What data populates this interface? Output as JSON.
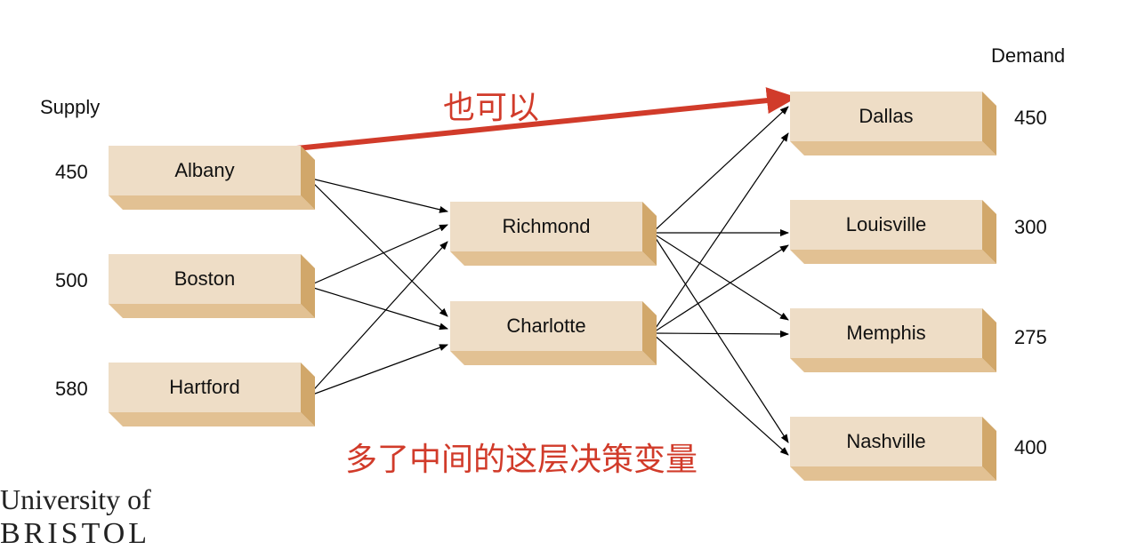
{
  "headers": {
    "supply": "Supply",
    "demand": "Demand"
  },
  "sources": [
    {
      "name": "Albany",
      "supply": "450"
    },
    {
      "name": "Boston",
      "supply": "500"
    },
    {
      "name": "Hartford",
      "supply": "580"
    }
  ],
  "hubs": [
    {
      "name": "Richmond"
    },
    {
      "name": "Charlotte"
    }
  ],
  "destinations": [
    {
      "name": "Dallas",
      "demand": "450"
    },
    {
      "name": "Louisville",
      "demand": "300"
    },
    {
      "name": "Memphis",
      "demand": "275"
    },
    {
      "name": "Nashville",
      "demand": "400"
    }
  ],
  "annotations": {
    "direct_arrow": "也可以",
    "middle_layer": "多了中间的这层决策变量"
  },
  "logo": {
    "line1": "University of",
    "line2": "BRISTOL"
  },
  "colors": {
    "box_face": "#eeddc6",
    "box_side": "#d1a76a",
    "box_bottom": "#e2c193",
    "accent": "#d13b2a"
  }
}
